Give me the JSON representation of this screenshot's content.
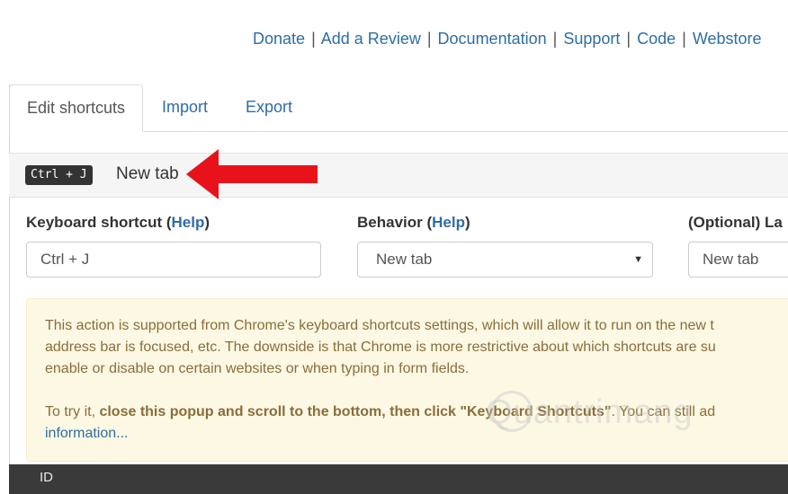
{
  "header": {
    "links": [
      "Donate",
      "Add a Review",
      "Documentation",
      "Support",
      "Code",
      "Webstore"
    ],
    "separator": "|"
  },
  "tabs": [
    {
      "label": "Edit shortcuts",
      "active": true
    },
    {
      "label": "Import",
      "active": false
    },
    {
      "label": "Export",
      "active": false
    }
  ],
  "shortcut": {
    "kbd": "Ctrl + J",
    "label": "New tab",
    "arrow_color": "#e8131a"
  },
  "fields": {
    "keyboard_label": "Keyboard shortcut",
    "keyboard_help": "Help",
    "keyboard_value": "Ctrl + J",
    "behavior_label": "Behavior",
    "behavior_help": "Help",
    "behavior_value": "New tab",
    "optional_label": "(Optional) La",
    "optional_value": "New tab"
  },
  "alert": {
    "line1": "This action is supported from Chrome's keyboard shortcuts settings, which will allow it to run on the new t",
    "line2": "address bar is focused, etc. The downside is that Chrome is more restrictive about which shortcuts are su",
    "line3": "enable or disable on certain websites or when typing in form fields.",
    "try_prefix": "To try it, ",
    "try_bold": "close this popup and scroll to the bottom, then click \"Keyboard Shortcuts\"",
    "try_suffix": ". You can still ad",
    "info_link": "information..."
  },
  "watermark": "Quantrimang",
  "footer": {
    "label": "ID"
  }
}
